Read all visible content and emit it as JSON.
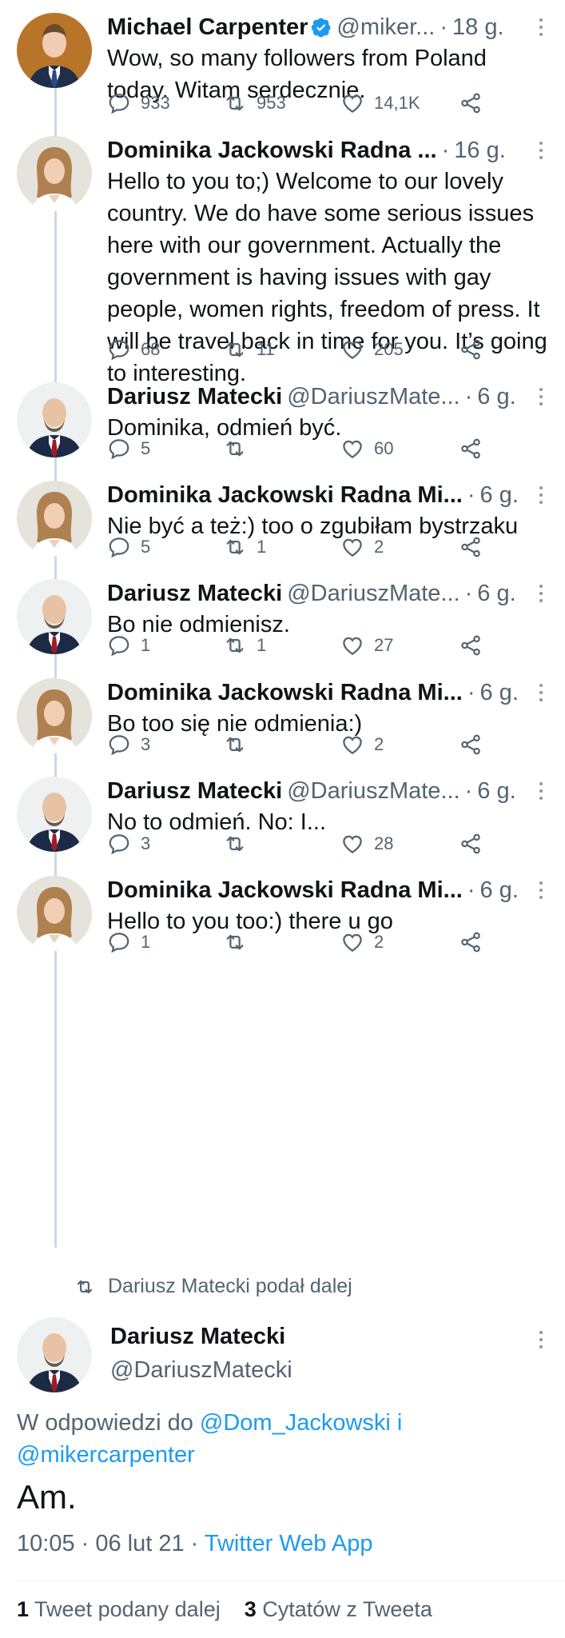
{
  "tweets": [
    {
      "name": "Michael Carpenter",
      "verified": true,
      "handle": "@miker...",
      "time": "18 g.",
      "text": "Wow, so many followers from Poland today. Witam serdecznie.",
      "replies": "933",
      "retweets": "953",
      "likes": "14,1K",
      "avatar": "man-tie"
    },
    {
      "name": "Dominika Jackowski Radna ...",
      "verified": false,
      "handle": "",
      "time": "16 g.",
      "text": "Hello to you to;) Welcome to our lovely country. We do have some serious issues here with our government. Actually the government is having issues with gay people, women rights, freedom of press. It will be travel back in time for you. It’s going to interesting.",
      "replies": "68",
      "retweets": "11",
      "likes": "205",
      "avatar": "woman"
    },
    {
      "name": "Dariusz Matecki",
      "verified": false,
      "handle": "@DariuszMate...",
      "time": "6 g.",
      "text": "Dominika, odmień być.",
      "replies": "5",
      "retweets": "",
      "likes": "60",
      "avatar": "man-bald"
    },
    {
      "name": "Dominika Jackowski Radna Mi...",
      "verified": false,
      "handle": "",
      "time": "6 g.",
      "text": "Nie być a też:) too o zgubiłam bystrzaku",
      "replies": "5",
      "retweets": "1",
      "likes": "2",
      "avatar": "woman"
    },
    {
      "name": "Dariusz Matecki",
      "verified": false,
      "handle": "@DariuszMate...",
      "time": "6 g.",
      "text": "Bo nie odmienisz.",
      "replies": "1",
      "retweets": "1",
      "likes": "27",
      "avatar": "man-bald"
    },
    {
      "name": "Dominika Jackowski Radna Mi...",
      "verified": false,
      "handle": "",
      "time": "6 g.",
      "text": "Bo too się nie odmienia:)",
      "replies": "3",
      "retweets": "",
      "likes": "2",
      "avatar": "woman"
    },
    {
      "name": "Dariusz Matecki",
      "verified": false,
      "handle": "@DariuszMate...",
      "time": "6 g.",
      "text": "No to odmień. No: I...",
      "replies": "3",
      "retweets": "",
      "likes": "28",
      "avatar": "man-bald"
    },
    {
      "name": "Dominika Jackowski Radna Mi...",
      "verified": false,
      "handle": "",
      "time": "6 g.",
      "text": "Hello to you too:) there u go",
      "replies": "1",
      "retweets": "",
      "likes": "2",
      "avatar": "woman"
    }
  ],
  "retweeted_by": "Dariusz Matecki podał dalej",
  "main": {
    "name": "Dariusz Matecki",
    "handle": "@DariuszMatecki",
    "reply_prefix": "W odpowiedzi do",
    "reply_user1": "@Dom_Jackowski",
    "reply_join": "i",
    "reply_user2": "@mikercarpenter",
    "text": "Am.",
    "timestamp": "10:05 · 06 lut 21 ·",
    "app": "Twitter Web App",
    "retweets_count": "1",
    "retweets_label": "Tweet podany dalej",
    "quotes_count": "3",
    "quotes_label": "Cytatów z Tweeta"
  },
  "colors": {
    "link": "#1d9bf0",
    "secondary": "#536471",
    "line": "#cfd9de"
  }
}
